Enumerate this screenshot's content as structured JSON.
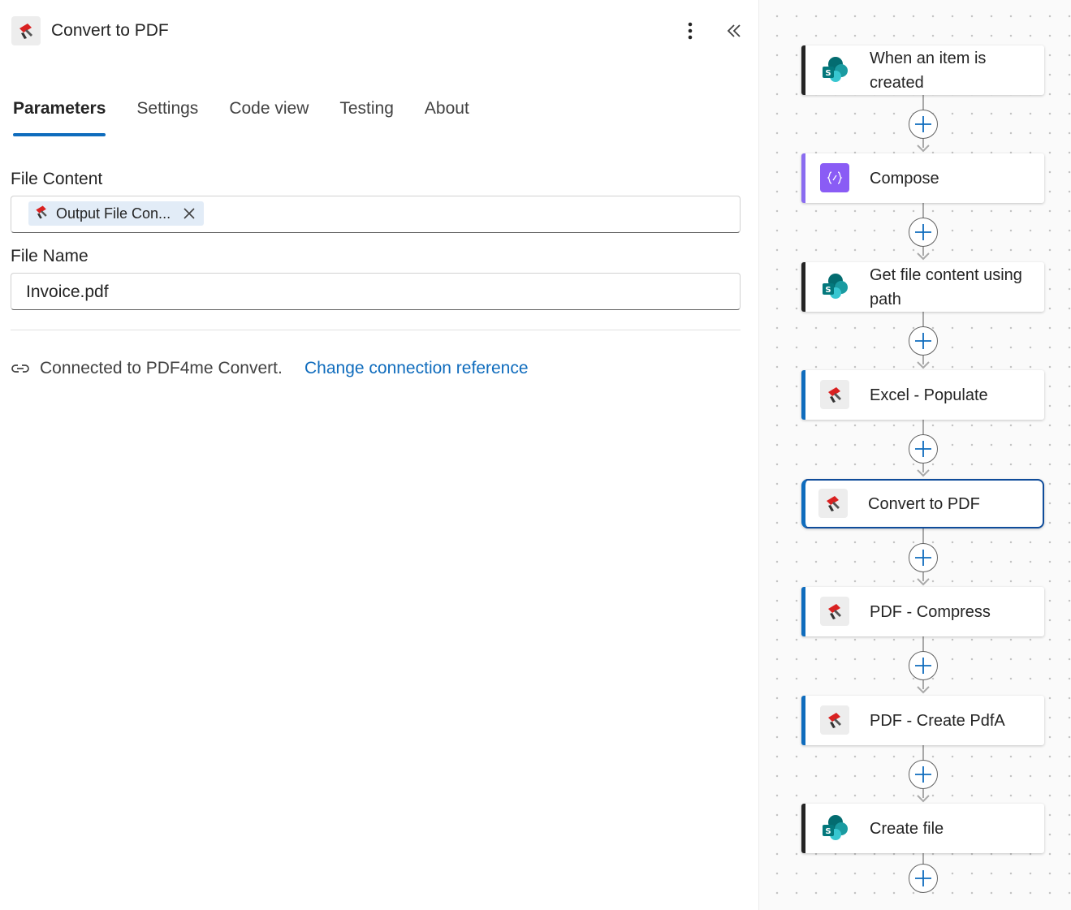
{
  "panel": {
    "title": "Convert to PDF",
    "tabs": [
      {
        "label": "Parameters",
        "active": true
      },
      {
        "label": "Settings",
        "active": false
      },
      {
        "label": "Code view",
        "active": false
      },
      {
        "label": "Testing",
        "active": false
      },
      {
        "label": "About",
        "active": false
      }
    ],
    "fields": {
      "file_content": {
        "label": "File Content",
        "token": "Output File Con..."
      },
      "file_name": {
        "label": "File Name",
        "value": "Invoice.pdf"
      }
    },
    "connection": {
      "text": "Connected to PDF4me Convert.",
      "link": "Change connection reference"
    }
  },
  "flow": {
    "steps": [
      {
        "title": "When an item is created",
        "icon": "sharepoint-icon",
        "accent": "#242424"
      },
      {
        "title": "Compose",
        "icon": "compose-icon",
        "accent": "#8a6cf0"
      },
      {
        "title": "Get file content using path",
        "icon": "sharepoint-icon",
        "accent": "#242424"
      },
      {
        "title": "Excel - Populate",
        "icon": "pdf4me-icon",
        "accent": "#0f6cbd"
      },
      {
        "title": "Convert to PDF",
        "icon": "pdf4me-icon",
        "accent": "#0f6cbd",
        "selected": true
      },
      {
        "title": "PDF - Compress",
        "icon": "pdf4me-icon",
        "accent": "#0f6cbd"
      },
      {
        "title": "PDF - Create PdfA",
        "icon": "pdf4me-icon",
        "accent": "#0f6cbd"
      },
      {
        "title": "Create file",
        "icon": "sharepoint-icon",
        "accent": "#242424"
      }
    ]
  },
  "colors": {
    "accent_blue": "#0f6cbd",
    "selected_border": "#0f4c9a",
    "compose_purple": "#8a5cf5",
    "pdf4me_red": "#d92121"
  }
}
